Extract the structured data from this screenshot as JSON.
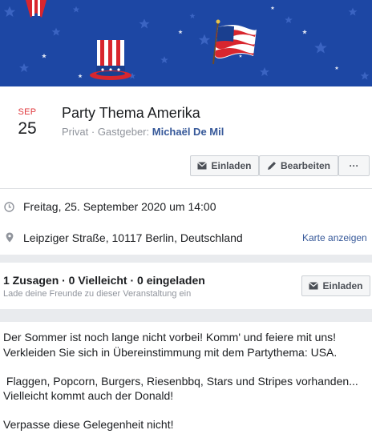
{
  "event": {
    "month": "SEP",
    "day": "25",
    "title": "Party Thema Amerika",
    "privacy": "Privat",
    "host_label": "Gastgeber:",
    "host_name": "Michaël De Mil"
  },
  "actions": {
    "invite_label": "Einladen",
    "edit_label": "Bearbeiten",
    "more_label": "···"
  },
  "details": {
    "datetime": "Freitag, 25. September 2020 um 14:00",
    "location": "Leipziger Straße, 10117 Berlin, Deutschland",
    "map_link": "Karte anzeigen"
  },
  "guests": {
    "summary": "1 Zusagen · 0 Vielleicht · 0 eingeladen",
    "hint": "Lade deine Freunde zu dieser Veranstaltung ein",
    "invite_label": "Einladen"
  },
  "description": {
    "line1": "Der Sommer ist noch lange nicht vorbei! Komm' und feiere mit uns!",
    "line2": "Verkleiden Sie sich in Übereinstimmung mit dem Partythema: USA.",
    "line3": " Flaggen, Popcorn, Burgers, Riesenbbq, Stars und Stripes vorhanden...",
    "line4": "Vielleicht kommt auch der Donald!",
    "line5": "Verpasse diese Gelegenheit nicht!"
  },
  "colors": {
    "cover_blue": "#1d47a4",
    "date_red": "#e0393e",
    "link_blue": "#365899",
    "muted_gray": "#90949c"
  }
}
